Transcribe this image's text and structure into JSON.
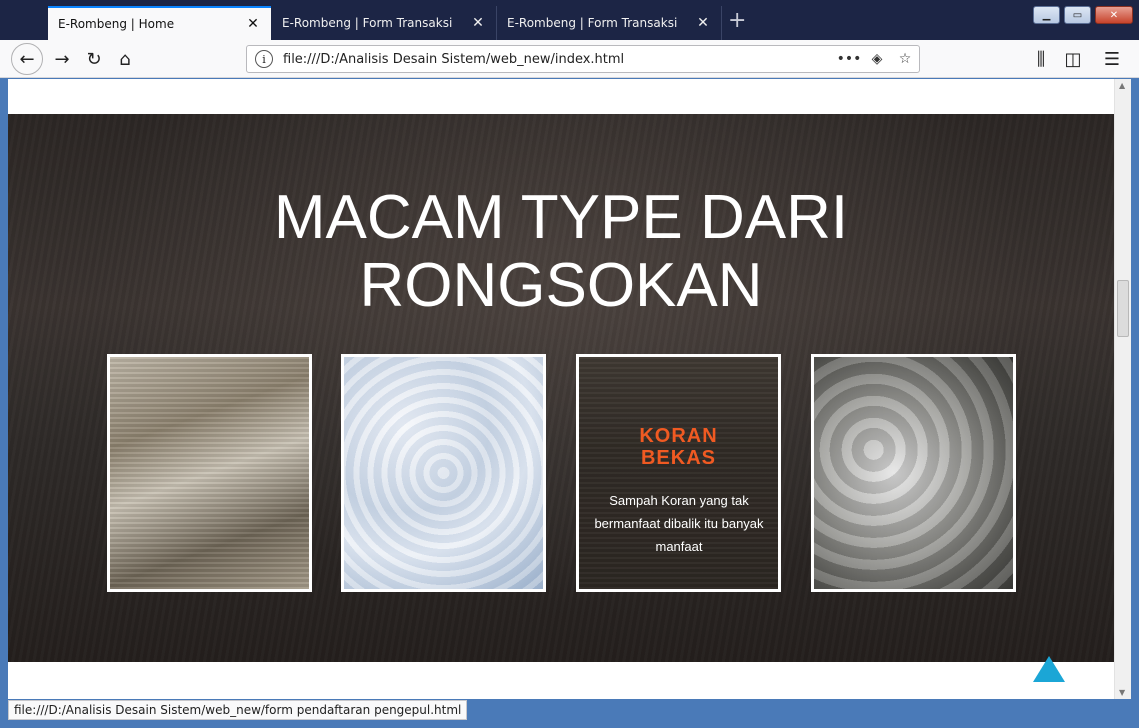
{
  "browser": {
    "tabs": [
      {
        "title": "E-Rombeng | Home",
        "active": true
      },
      {
        "title": "E-Rombeng | Form Transaksi",
        "active": false
      },
      {
        "title": "E-Rombeng | Form Transaksi",
        "active": false
      }
    ],
    "new_tab_icon": "plus-icon",
    "url": "file:///D:/Analisis Desain Sistem/web_new/index.html",
    "page_actions_icon": "more-icon",
    "status_text": "file:///D:/Analisis Desain Sistem/web_new/form pendaftaran pengepul.html",
    "accent_color": "#0a84ff"
  },
  "hero": {
    "title_line1": "MACAM TYPE DARI",
    "title_line2": "RONGSOKAN"
  },
  "cards": [
    {
      "image": "cardboard-waste-photo"
    },
    {
      "image": "plastic-bottles-photo"
    },
    {
      "image": "newspaper-stack-photo",
      "title_line1": "KORAN",
      "title_line2": "BEKAS",
      "description": "Sampah Koran yang tak bermanfaat dibalik itu banyak manfaat",
      "title_color": "#f05a22"
    },
    {
      "image": "sacks-waste-photo"
    }
  ],
  "back_to_top": {
    "icon": "arrow-up-icon",
    "color": "#1ba6d6"
  }
}
